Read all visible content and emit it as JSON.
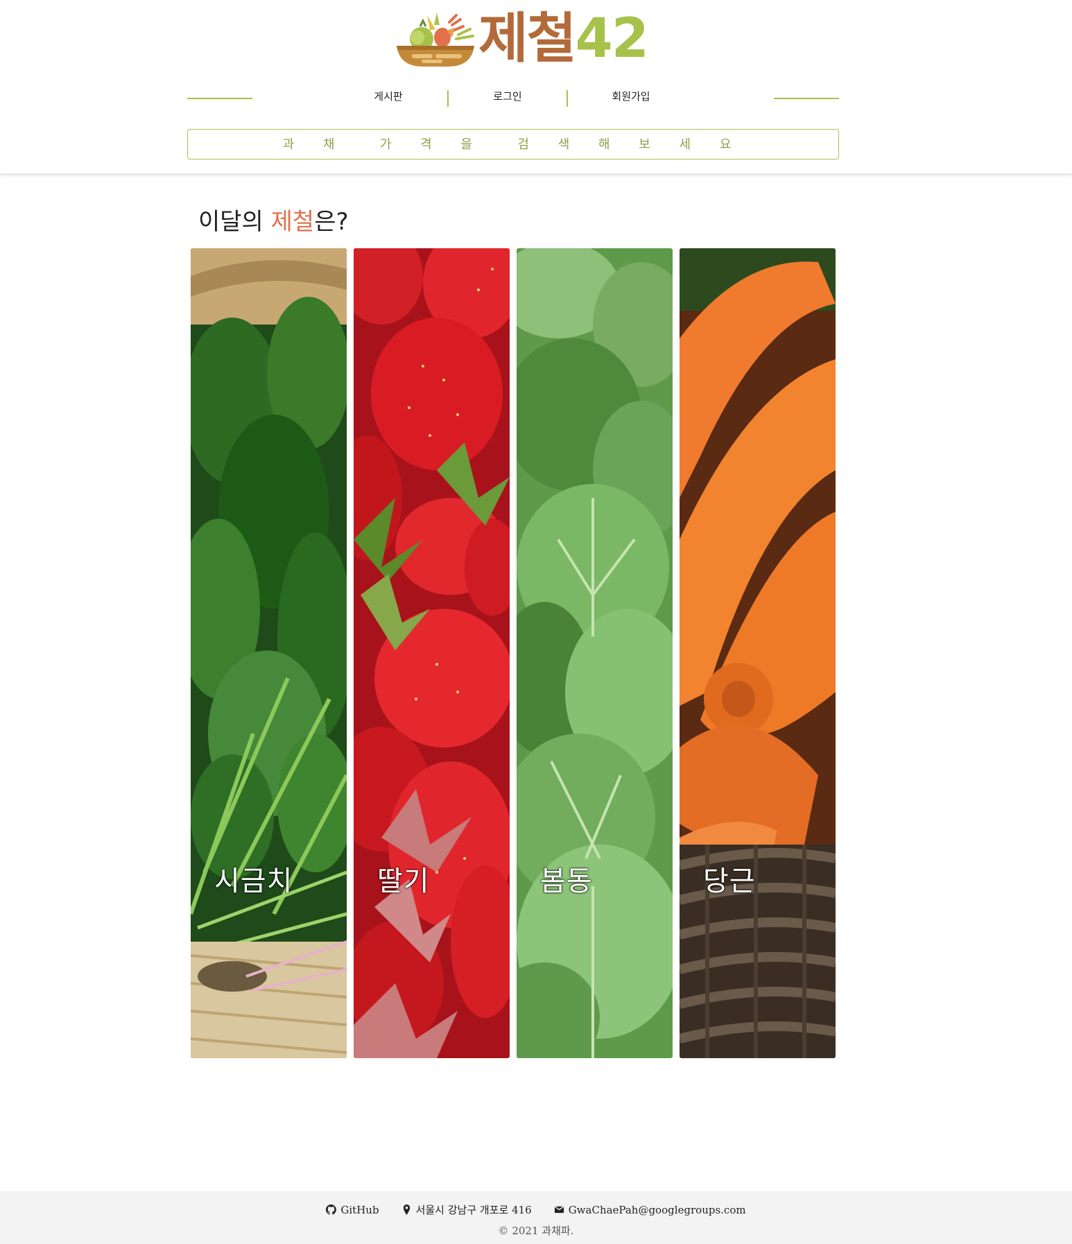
{
  "header": {
    "logo": {
      "text_ko": "제철",
      "text_num": "42"
    },
    "nav": [
      {
        "label": "게시판"
      },
      {
        "label": "로그인"
      },
      {
        "label": "회원가입"
      }
    ],
    "search": {
      "placeholder": "과 채  가 격 을  검 색 해 보 세 요"
    }
  },
  "main": {
    "title_prefix": "이달의 ",
    "title_highlight": "제철",
    "title_suffix": "은?",
    "produce": [
      {
        "label": "시금치",
        "icon": "spinach-image"
      },
      {
        "label": "딸기",
        "icon": "strawberry-image"
      },
      {
        "label": "봄동",
        "icon": "spring-cabbage-image"
      },
      {
        "label": "당근",
        "icon": "carrot-image"
      }
    ]
  },
  "footer": {
    "github": "GitHub",
    "address": "서울시 강남구 개포로 416",
    "email": "GwaChaePah@googlegroups.com",
    "copyright": "2021 과채파."
  },
  "colors": {
    "brand_brown": "#b36a3a",
    "brand_green": "#a7c24a",
    "highlight": "#e2704d"
  }
}
